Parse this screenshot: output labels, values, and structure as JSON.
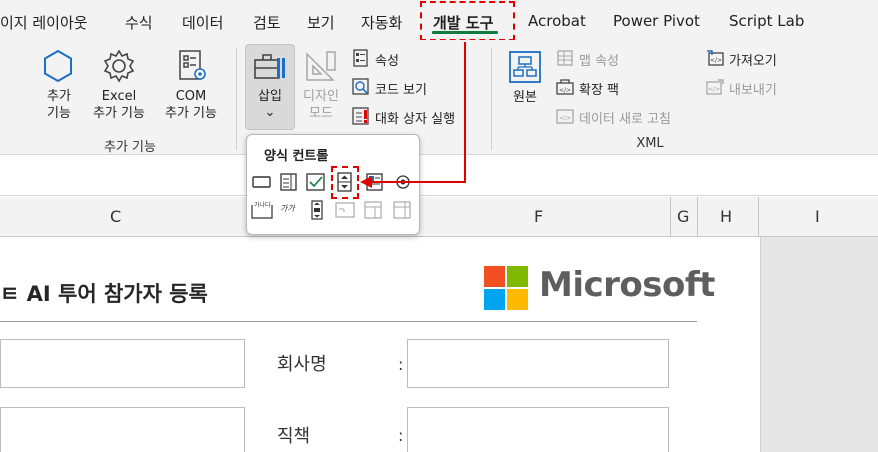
{
  "tabs": [
    {
      "label": "이지 레이아웃",
      "active": false
    },
    {
      "label": "수식",
      "active": false
    },
    {
      "label": "데이터",
      "active": false
    },
    {
      "label": "검토",
      "active": false
    },
    {
      "label": "보기",
      "active": false
    },
    {
      "label": "자동화",
      "active": false
    },
    {
      "label": "개발 도구",
      "active": true
    },
    {
      "label": "Acrobat",
      "active": false
    },
    {
      "label": "Power Pivot",
      "active": false
    },
    {
      "label": "Script Lab",
      "active": false
    }
  ],
  "ribbon": {
    "addins_group": {
      "label": "추가 기능",
      "buttons": [
        {
          "label_line1": "추가",
          "label_line2": "기능",
          "icon": "hexagon-icon"
        },
        {
          "label_line1": "Excel",
          "label_line2": "추가 기능",
          "icon": "gear-icon"
        },
        {
          "label_line1": "COM",
          "label_line2": "추가 기능",
          "icon": "com-addin-icon"
        }
      ]
    },
    "controls_group": {
      "insert": {
        "label": "삽입",
        "chevron": "⌄",
        "icon": "toolbox-icon"
      },
      "design_mode": {
        "label_line1": "디자인",
        "label_line2": "모드",
        "icon": "ruler-triangle-icon",
        "disabled": true
      },
      "properties": {
        "label": "속성",
        "icon": "properties-icon"
      },
      "view_code": {
        "label": "코드 보기",
        "icon": "view-code-icon"
      },
      "run_dialog": {
        "label": "대화 상자 실행",
        "icon": "run-dialog-icon"
      }
    },
    "xml_group": {
      "label": "XML",
      "source": {
        "label": "원본",
        "icon": "xml-source-icon"
      },
      "map_properties": {
        "label": "맵 속성",
        "disabled": true
      },
      "expansion_packs": {
        "label": "확장 팩",
        "disabled": false
      },
      "refresh_data": {
        "label": "데이터 새로 고침",
        "disabled": true
      },
      "import": {
        "label": "가져오기",
        "disabled": false
      },
      "export": {
        "label": "내보내기",
        "disabled": true
      }
    }
  },
  "form_controls_popup": {
    "title": "양식 컨트롤",
    "items_row1": [
      "button-control-icon",
      "combo-box-icon",
      "checkbox-control-icon",
      "spin-button-icon",
      "list-box-icon",
      "option-button-icon"
    ],
    "items_row2": [
      "group-box-icon",
      "label-control-icon",
      "scroll-bar-icon",
      "text-field-icon",
      "combo-list-edit-icon",
      "combo-drop-edit-icon"
    ],
    "label_text": "가가",
    "group_text": "가나다"
  },
  "columns": [
    "C",
    "F",
    "G",
    "H",
    "I"
  ],
  "sheet": {
    "form_title": "ㅌ AI 투어 참가자 등록",
    "logo_text": "Microsoft",
    "logo_colors": [
      "#f25022",
      "#7fba00",
      "#00a4ef",
      "#ffb900"
    ],
    "fields": [
      {
        "label": "회사명",
        "colon": ":",
        "value": ""
      },
      {
        "label": "직책",
        "colon": ":",
        "value": ""
      }
    ]
  },
  "colors": {
    "accent": "#107c41",
    "highlight": "#e00000"
  }
}
